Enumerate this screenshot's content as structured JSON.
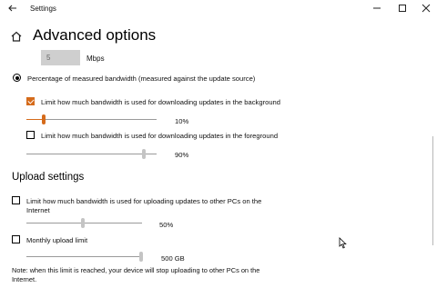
{
  "window": {
    "title": "Settings",
    "back_icon": "back-arrow-icon",
    "minimize_icon": "minimize-icon",
    "maximize_icon": "maximize-icon",
    "close_icon": "close-icon"
  },
  "page": {
    "heading": "Advanced options",
    "home_icon": "home-icon"
  },
  "download": {
    "mbps_value": "5",
    "mbps_unit": "Mbps",
    "percentage_option_label": "Percentage of measured bandwidth (measured against the update source)",
    "background": {
      "label": "Limit how much bandwidth is used for downloading updates in the background",
      "checked": true,
      "value_label": "10%",
      "value": 0.1
    },
    "foreground": {
      "label": "Limit how much bandwidth is used for downloading updates in the foreground",
      "checked": false,
      "value_label": "90%",
      "value": 0.9
    }
  },
  "upload": {
    "section_title": "Upload settings",
    "other_pcs": {
      "label_line1": "Limit how much bandwidth is used for uploading updates to other PCs on the",
      "label_line2": "Internet",
      "checked": false,
      "value_label": "50%",
      "value": 0.5
    },
    "monthly": {
      "label": "Monthly upload limit",
      "checked": false,
      "value_label": "500 GB"
    },
    "note_line1": "Note: when this limit is reached, your device will stop uploading to other PCs on the",
    "note_line2": "Internet."
  },
  "colors": {
    "accent": "#d56b1b",
    "track": "#9a9a9a",
    "disabled_box": "#cfcfcf"
  }
}
